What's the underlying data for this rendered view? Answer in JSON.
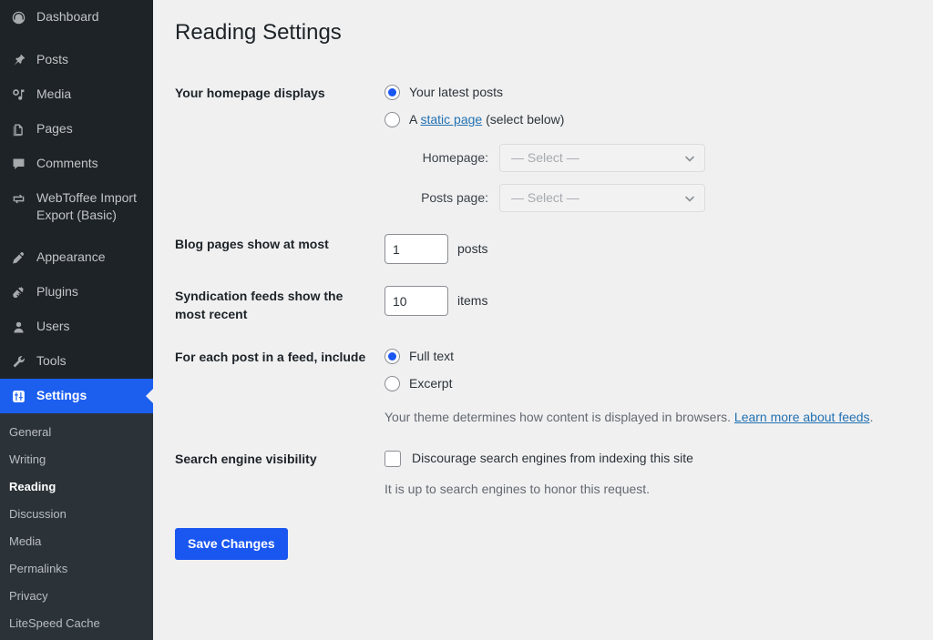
{
  "sidebar": {
    "items": [
      {
        "label": "Dashboard",
        "icon": "dashboard-icon",
        "active": false,
        "gap_after": true
      },
      {
        "label": "Posts",
        "icon": "pin-icon",
        "active": false,
        "gap_after": false
      },
      {
        "label": "Media",
        "icon": "media-icon",
        "active": false,
        "gap_after": false
      },
      {
        "label": "Pages",
        "icon": "pages-icon",
        "active": false,
        "gap_after": false
      },
      {
        "label": "Comments",
        "icon": "comments-icon",
        "active": false,
        "gap_after": false
      },
      {
        "label": "WebToffee Import Export (Basic)",
        "icon": "import-export-icon",
        "active": false,
        "gap_after": true
      },
      {
        "label": "Appearance",
        "icon": "appearance-icon",
        "active": false,
        "gap_after": false
      },
      {
        "label": "Plugins",
        "icon": "plugins-icon",
        "active": false,
        "gap_after": false
      },
      {
        "label": "Users",
        "icon": "users-icon",
        "active": false,
        "gap_after": false
      },
      {
        "label": "Tools",
        "icon": "tools-icon",
        "active": false,
        "gap_after": false
      },
      {
        "label": "Settings",
        "icon": "settings-icon",
        "active": true,
        "gap_after": false
      }
    ],
    "submenu": [
      {
        "label": "General",
        "current": false
      },
      {
        "label": "Writing",
        "current": false
      },
      {
        "label": "Reading",
        "current": true
      },
      {
        "label": "Discussion",
        "current": false
      },
      {
        "label": "Media",
        "current": false
      },
      {
        "label": "Permalinks",
        "current": false
      },
      {
        "label": "Privacy",
        "current": false
      },
      {
        "label": "LiteSpeed Cache",
        "current": false
      }
    ],
    "colors": {
      "background": "#1d2327",
      "submenu_background": "#2c3338",
      "active_background": "#1c5fef"
    }
  },
  "page": {
    "title": "Reading Settings"
  },
  "homepage_displays": {
    "label": "Your homepage displays",
    "options": [
      {
        "text": "Your latest posts",
        "selected": true
      },
      {
        "text_before": "A ",
        "link_text": "static page",
        "text_after": " (select below)",
        "selected": false
      }
    ],
    "homepage_select": {
      "label": "Homepage:",
      "value": "— Select —"
    },
    "posts_page_select": {
      "label": "Posts page:",
      "value": "— Select —"
    }
  },
  "blog_pages": {
    "label": "Blog pages show at most",
    "value": "1",
    "unit": "posts"
  },
  "syndication_feeds": {
    "label": "Syndication feeds show the most recent",
    "value": "10",
    "unit": "items"
  },
  "feed_include": {
    "label": "For each post in a feed, include",
    "options": [
      {
        "text": "Full text",
        "selected": true
      },
      {
        "text": "Excerpt",
        "selected": false
      }
    ],
    "description_before": "Your theme determines how content is displayed in browsers. ",
    "description_link": "Learn more about feeds",
    "description_after": "."
  },
  "search_visibility": {
    "label": "Search engine visibility",
    "checkbox_label": "Discourage search engines from indexing this site",
    "checked": false,
    "description": "It is up to search engines to honor this request."
  },
  "submit": {
    "label": "Save Changes",
    "color": "#1a56f0"
  }
}
